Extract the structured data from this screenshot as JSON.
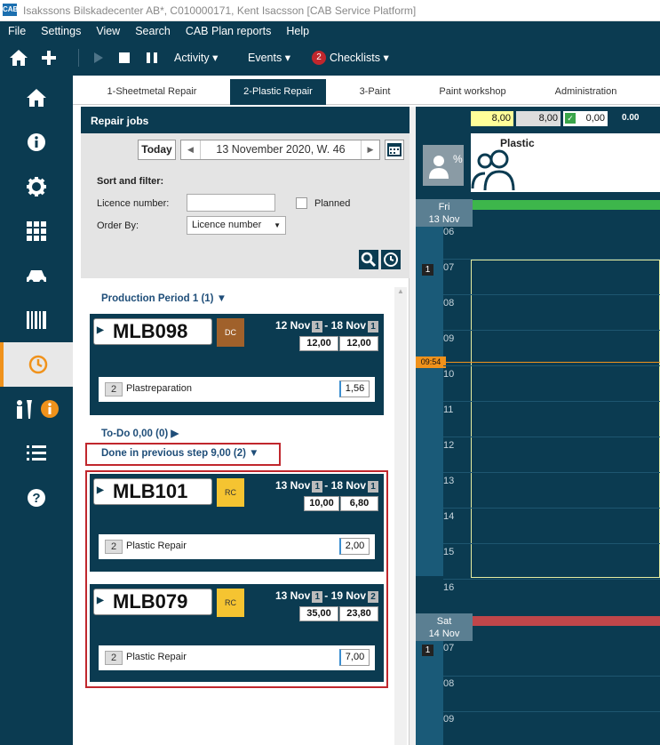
{
  "window": {
    "title": "Isakssons Bilskadecenter AB*, C010000171, Kent Isacsson [CAB Service Platform]",
    "app_icon": "CAB"
  },
  "menu": [
    "File",
    "Settings",
    "View",
    "Search",
    "CAB Plan reports",
    "Help"
  ],
  "toolbar": {
    "activity": "Activity",
    "events": "Events",
    "checklists_badge": "2",
    "checklists": "Checklists"
  },
  "nav_icons": [
    "home-icon",
    "info-icon",
    "gear-icon",
    "grid-icon",
    "car-icon",
    "barcode-icon",
    "clock-icon",
    "worker-icon",
    "list-icon",
    "help-icon"
  ],
  "tabs": [
    "1-Sheetmetal Repair",
    "2-Plastic Repair",
    "3-Paint",
    "Paint workshop",
    "Administration"
  ],
  "repair_jobs": {
    "title": "Repair jobs",
    "today": "Today",
    "date": "13 November 2020, W. 46",
    "sort_filter": "Sort and filter:",
    "licence_label": "Licence number:",
    "licence_value": "",
    "planned": "Planned",
    "order_by_label": "Order By:",
    "order_by_value": "Licence number"
  },
  "sections": {
    "production": "Production Period 1 (1)",
    "todo": "To-Do 0,00 (0)",
    "done": "Done in previous step 9,00 (2)"
  },
  "cards": [
    {
      "plate": "MLB098",
      "badge": "DC",
      "badge_color": "#a0612b",
      "from": "12 Nov",
      "from_wk": "1",
      "to": "18 Nov",
      "to_wk": "1",
      "v1": "12,00",
      "v2": "12,00",
      "step_no": "2",
      "step": "Plastreparation",
      "step_val": "1,56"
    },
    {
      "plate": "MLB101",
      "badge": "RC",
      "badge_color": "#f5c431",
      "from": "13 Nov",
      "from_wk": "1",
      "to": "18 Nov",
      "to_wk": "1",
      "v1": "10,00",
      "v2": "6,80",
      "step_no": "2",
      "step": "Plastic Repair",
      "step_val": "2,00"
    },
    {
      "plate": "MLB079",
      "badge": "RC",
      "badge_color": "#f5c431",
      "from": "13 Nov",
      "from_wk": "1",
      "to": "19 Nov",
      "to_wk": "2",
      "v1": "35,00",
      "v2": "23,80",
      "step_no": "2",
      "step": "Plastic Repair",
      "step_val": "7,00"
    }
  ],
  "calendar": {
    "top_vals": [
      "8,00",
      "8,00",
      "0,00",
      "0.00"
    ],
    "resource": "Plastic",
    "day1": "Fri",
    "day1_date": "13 Nov",
    "day2": "Sat",
    "day2_date": "14 Nov",
    "hours1": [
      "06",
      "07",
      "08",
      "09",
      "10",
      "11",
      "12",
      "13",
      "14",
      "15",
      "16"
    ],
    "hours2": [
      "07",
      "08",
      "09"
    ],
    "now": "09:54",
    "marker": "1"
  }
}
